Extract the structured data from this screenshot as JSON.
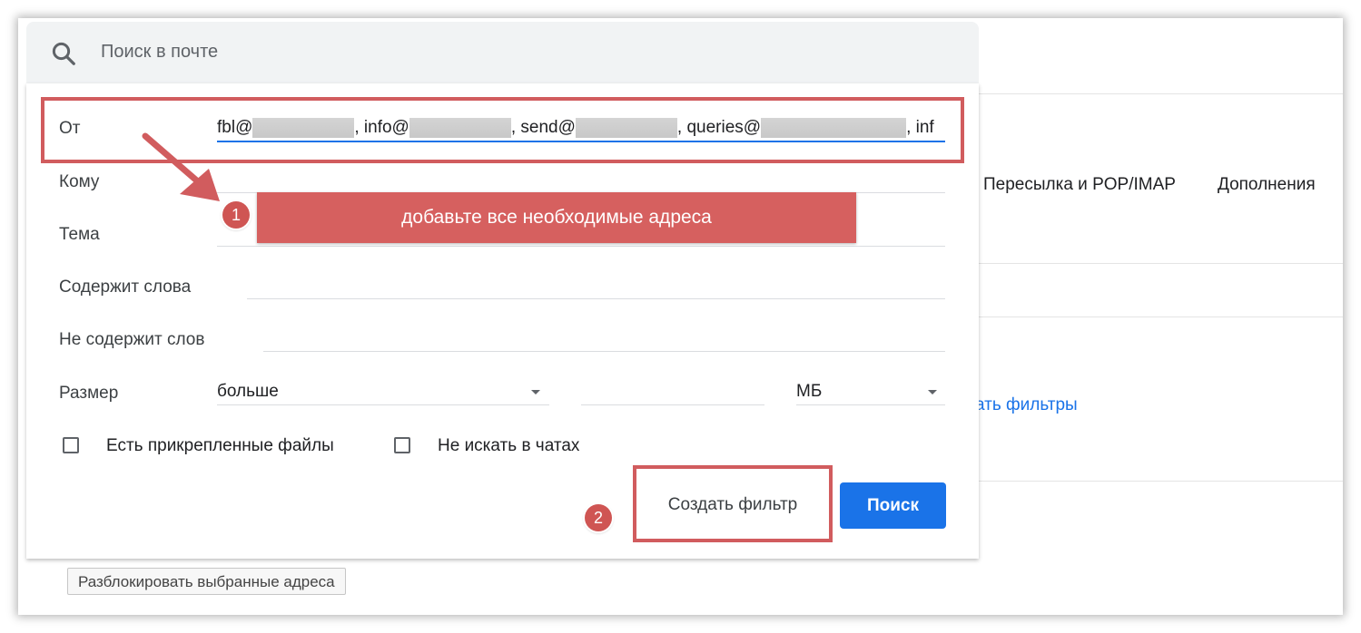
{
  "search": {
    "placeholder": "Поиск в почте"
  },
  "filter": {
    "from_label": "От",
    "from_value_segments": [
      "fbl@",
      ", info@",
      ", send@",
      ", queries@",
      ", inf"
    ],
    "to_label": "Кому",
    "subject_label": "Тема",
    "has_words_label": "Содержит слова",
    "not_words_label": "Не содержит слов",
    "size_label": "Размер",
    "size_compare_value": "больше",
    "size_unit_value": "МБ",
    "attachments_label": "Есть прикрепленные файлы",
    "no_chats_label": "Не искать в чатах",
    "create_filter_label": "Создать фильтр",
    "search_button_label": "Поиск"
  },
  "annotations": {
    "step1_number": "1",
    "step1_text": "добавьте все необходимые адреса",
    "step2_number": "2",
    "color": "#d15c5e"
  },
  "background": {
    "tab_forwarding": "Пересылка и POP/IMAP",
    "tab_addons": "Дополнения",
    "link_filters": "ать фильтры",
    "unblock_button": "Разблокировать выбранные адреса"
  },
  "colors": {
    "accent": "#1a73e8",
    "searchbar_bg": "#f1f3f4"
  }
}
